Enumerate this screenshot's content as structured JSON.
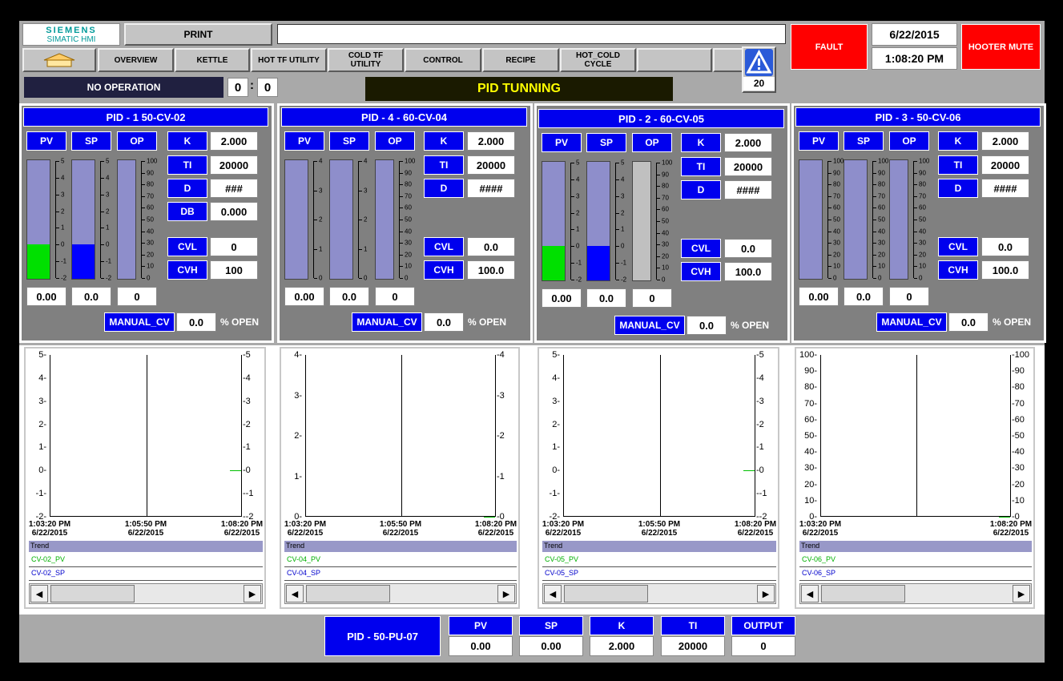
{
  "header": {
    "logo_top": "SIEMENS",
    "logo_bottom": "SIMATIC HMI",
    "print": "PRINT",
    "date": "6/22/2015",
    "time": "1:08:20 PM",
    "fault": "FAULT",
    "hooter": "HOOTER MUTE",
    "alarm_count": "20"
  },
  "nav": {
    "items": [
      "OVERVIEW",
      "KETTLE",
      "HOT TF UTILITY",
      "COLD TF UTILITY",
      "CONTROL",
      "RECIPE",
      "HOT_COLD CYCLE"
    ]
  },
  "status": {
    "operation": "NO OPERATION",
    "counter_a": "0",
    "counter_sep": ":",
    "counter_b": "0",
    "title": "PID TUNNING"
  },
  "labels": {
    "pv": "PV",
    "sp": "SP",
    "op": "OP",
    "k": "K",
    "ti": "TI",
    "d": "D",
    "db": "DB",
    "cvl": "CVL",
    "cvh": "CVH",
    "manual": "MANUAL_CV",
    "open": "% OPEN",
    "trend": "Trend"
  },
  "pids": [
    {
      "title": "PID - 1 50-CV-02",
      "pv": "0.00",
      "sp": "0.0",
      "op": "0",
      "k": "2.000",
      "ti": "20000",
      "d": "###",
      "db": "0.000",
      "cvl": "0",
      "cvh": "100",
      "manual": "0.0",
      "pv_fill": 0.29,
      "sp_fill": 0.29,
      "op_fill": 0,
      "pv_color": "#00e000",
      "sp_color": "#0000ff",
      "op_bar_color": "#8e8ecb",
      "pvsp_ticks": [
        "5",
        "4",
        "3",
        "2",
        "1",
        "0",
        "-1",
        "-2"
      ],
      "op_ticks": [
        "100",
        "90",
        "80",
        "70",
        "60",
        "50",
        "40",
        "30",
        "20",
        "10",
        "0"
      ],
      "trend_y": [
        "5",
        "4",
        "3",
        "2",
        "1",
        "0",
        "-1",
        "-2"
      ],
      "trend_x": [
        [
          "1:03:20 PM",
          "6/22/2015"
        ],
        [
          "1:05:50 PM",
          "6/22/2015"
        ],
        [
          "1:08:20 PM",
          "6/22/2015"
        ]
      ],
      "pv_tag": "CV-02_PV",
      "sp_tag": "CV-02_SP"
    },
    {
      "title": "PID - 4 - 60-CV-04",
      "pv": "0.00",
      "sp": "0.0",
      "op": "0",
      "k": "2.000",
      "ti": "20000",
      "d": "####",
      "cvl": "0.0",
      "cvh": "100.0",
      "manual": "0.0",
      "pv_fill": 0,
      "sp_fill": 0,
      "op_fill": 0,
      "pv_color": "#00e000",
      "sp_color": "#0000ff",
      "op_bar_color": "#8e8ecb",
      "pvsp_ticks": [
        "4",
        "3",
        "2",
        "1",
        "0"
      ],
      "op_ticks": [
        "100",
        "90",
        "80",
        "70",
        "60",
        "50",
        "40",
        "30",
        "20",
        "10",
        "0"
      ],
      "trend_y": [
        "4",
        "3",
        "2",
        "1",
        "0"
      ],
      "trend_x": [
        [
          "1:03:20 PM",
          "6/22/2015"
        ],
        [
          "1:05:50 PM",
          "6/22/2015"
        ],
        [
          "1:08:20 PM",
          "6/22/2015"
        ]
      ],
      "pv_tag": "CV-04_PV",
      "sp_tag": "CV-04_SP"
    },
    {
      "title": "PID - 2 - 60-CV-05",
      "pv": "0.00",
      "sp": "0.0",
      "op": "0",
      "k": "2.000",
      "ti": "20000",
      "d": "####",
      "cvl": "0.0",
      "cvh": "100.0",
      "manual": "0.0",
      "pv_fill": 0.29,
      "sp_fill": 0.29,
      "op_fill": 0,
      "pv_color": "#00e000",
      "sp_color": "#0000ff",
      "op_bar_color": "#c0c0c0",
      "pvsp_ticks": [
        "5",
        "4",
        "3",
        "2",
        "1",
        "0",
        "-1",
        "-2"
      ],
      "op_ticks": [
        "100",
        "90",
        "80",
        "70",
        "60",
        "50",
        "40",
        "30",
        "20",
        "10",
        "0"
      ],
      "trend_y": [
        "5",
        "4",
        "3",
        "2",
        "1",
        "0",
        "-1",
        "-2"
      ],
      "trend_x": [
        [
          "1:03:20 PM",
          "6/22/2015"
        ],
        [
          "1:05:50 PM",
          "6/22/2015"
        ],
        [
          "1:08:20 PM",
          "6/22/2015"
        ]
      ],
      "pv_tag": "CV-05_PV",
      "sp_tag": "CV-05_SP"
    },
    {
      "title": "PID - 3 - 50-CV-06",
      "pv": "0.00",
      "sp": "0.0",
      "op": "0",
      "k": "2.000",
      "ti": "20000",
      "d": "####",
      "cvl": "0.0",
      "cvh": "100.0",
      "manual": "0.0",
      "pv_fill": 0,
      "sp_fill": 0,
      "op_fill": 0,
      "pv_color": "#00e000",
      "sp_color": "#0000ff",
      "op_bar_color": "#8e8ecb",
      "pvsp_ticks": [
        "100",
        "90",
        "80",
        "70",
        "60",
        "50",
        "40",
        "30",
        "20",
        "10",
        "0"
      ],
      "op_ticks": [
        "100",
        "90",
        "80",
        "70",
        "60",
        "50",
        "40",
        "30",
        "20",
        "10",
        "0"
      ],
      "trend_y": [
        "100",
        "90",
        "80",
        "70",
        "60",
        "50",
        "40",
        "30",
        "20",
        "10",
        "0"
      ],
      "trend_x": [
        [
          "1:03:20 PM",
          "6/22/2015"
        ],
        [
          "1:08:20 PM",
          "6/22/2015"
        ]
      ],
      "pv_tag": "CV-06_PV",
      "sp_tag": "CV-06_SP"
    }
  ],
  "bottom": {
    "title": "PID - 50-PU-07",
    "pv_label": "PV",
    "sp_label": "SP",
    "k_label": "K",
    "ti_label": "TI",
    "output_label": "OUTPUT",
    "pv": "0.00",
    "sp": "0.00",
    "k": "2.000",
    "ti": "20000",
    "output": "0"
  },
  "colors": {
    "screen": "#a9a9a9",
    "accent_blue": "#0000ee",
    "fault_red": "#ff0000",
    "title_bar": "#1a1a00",
    "title_text": "#ffff00"
  }
}
